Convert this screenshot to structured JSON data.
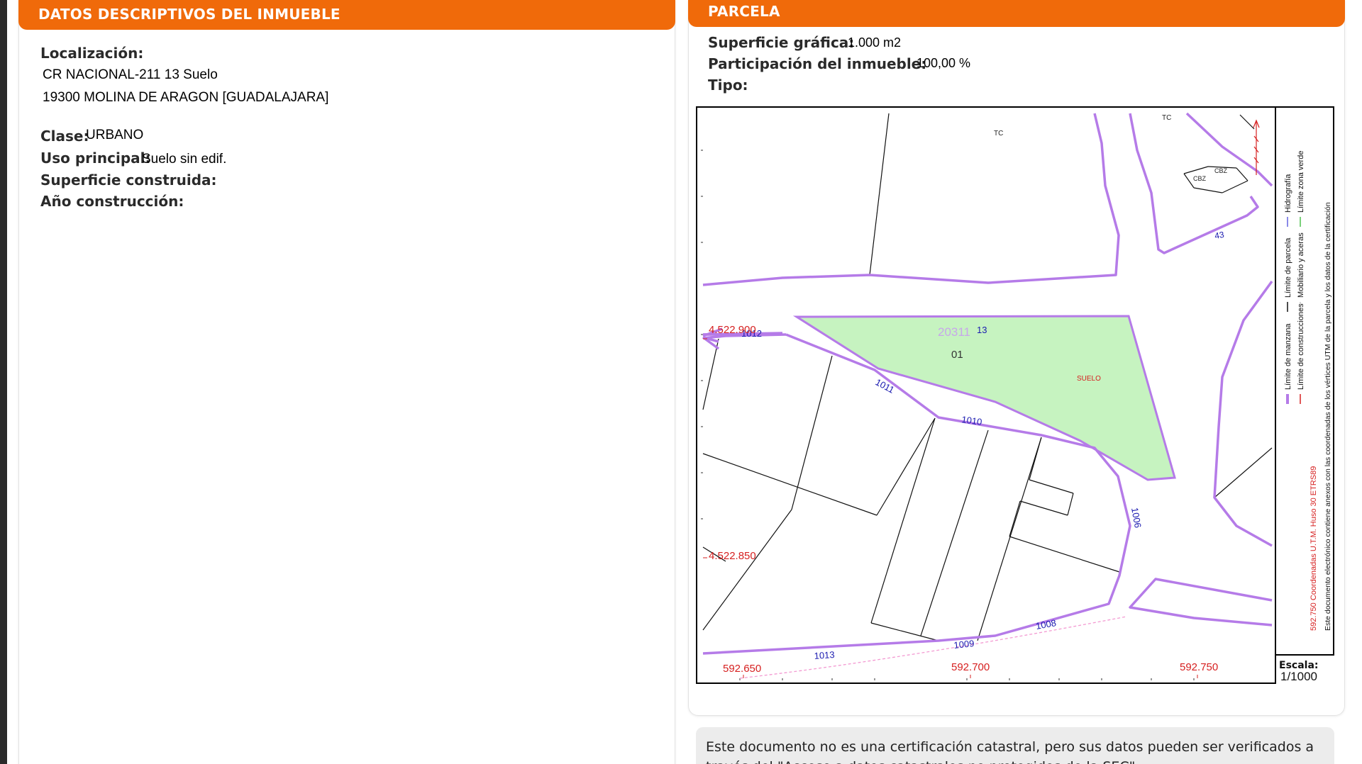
{
  "left_panel": {
    "header": "DATOS DESCRIPTIVOS DEL INMUEBLE",
    "localizacion_label": "Localización:",
    "localizacion_line1": "CR NACIONAL-211 13 Suelo",
    "localizacion_line2": "19300 MOLINA DE ARAGON [GUADALAJARA]",
    "clase_label": "Clase:",
    "clase_value": "URBANO",
    "uso_label": "Uso principal:",
    "uso_value": "Suelo sin edif.",
    "superficie_label": "Superficie construida:",
    "anio_label": "Año construcción:"
  },
  "right_panel": {
    "header": "PARCELA",
    "superficie_label": "Superficie gráfica:",
    "superficie_value": "1.000 m2",
    "participacion_label": "Participación del inmueble:",
    "participacion_value": "100,00 %",
    "tipo_label": "Tipo:"
  },
  "map": {
    "labels": {
      "tc1": "TC",
      "tc2": "TC",
      "cbz1": "CBZ",
      "cbz2": "CBZ",
      "n43": "43",
      "parcel_ref": "20311",
      "parcel_13": "13",
      "parcel_01": "01",
      "suelo": "SUELO",
      "n1012": "1012",
      "n1011": "1011",
      "n1010": "1010",
      "n1006": "1006",
      "n1008": "1008",
      "n1009": "1009",
      "n1013": "1013"
    },
    "coords": {
      "y1": "4.522.900",
      "y2": "4.522.850",
      "x1": "592.650",
      "x2": "592.700",
      "x3": "592.750"
    },
    "legend": {
      "manzana": "Límite de manzana",
      "parcela": "Límite de parcela",
      "hidrografia": "Hidrografía",
      "construcciones": "Límite de construcciones",
      "mobiliario": "Mobiliario y aceras",
      "zona_verde": "Límite zona verde",
      "coordenadas": "592.750 Coordenadas U.T.M. Huso 30 ETRS89",
      "nota": "Este documento electrónico contiene anexos con las coordenadas de los vértices UTM de la parcela y los datos de la certificación"
    },
    "scale_label": "Escala:",
    "scale_value": "1/1000",
    "colors": {
      "manzana": "#b57be8",
      "parcel_fill": "#c6f3c0",
      "coord_red": "#d62020",
      "number_blue": "#1a1ab0"
    }
  },
  "footer": {
    "text": "Este documento no es una certificación catastral, pero sus datos pueden ser verificados a través del \"Acceso a datos catastrales no protegidos de la SEC\""
  }
}
